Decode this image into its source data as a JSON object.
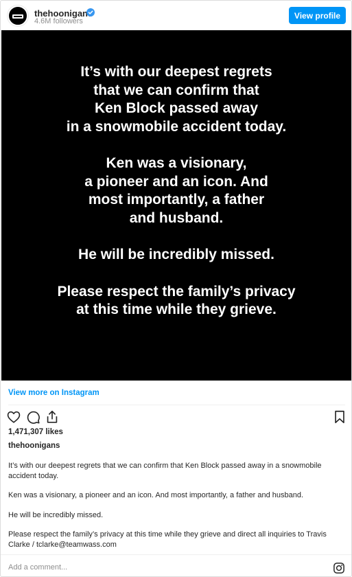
{
  "header": {
    "username": "thehoonigans",
    "followers": "4.6M followers",
    "view_profile_label": "View profile"
  },
  "post": {
    "text_paragraphs": [
      [
        "It’s with our deepest regrets",
        "that we can confirm that",
        "Ken Block passed away",
        "in a snowmobile accident today."
      ],
      [
        "Ken was a visionary,",
        "a pioneer and an icon. And",
        "most importantly, a father",
        "and husband."
      ],
      [
        "He will be incredibly missed."
      ],
      [
        "Please respect the family’s privacy",
        "at this time while they grieve."
      ]
    ]
  },
  "view_more_label": "View more on Instagram",
  "likes": "1,471,307 likes",
  "caption": {
    "username": "thehoonigans",
    "paragraphs": [
      "It’s with our deepest regrets that we can confirm that Ken Block passed away in a snowmobile accident today.",
      "Ken was a visionary, a pioneer and an icon. And most importantly, a father and husband.",
      "He will be incredibly missed.",
      "Please respect the family’s privacy at this time while they grieve and direct all inquiries to Travis Clarke / tclarke@teamwass.com"
    ]
  },
  "comment_placeholder": "Add a comment...",
  "colors": {
    "accent": "#0095f6",
    "verified": "#3897f0",
    "muted": "#8e8e8e",
    "post_background": "#000000"
  },
  "icons": {
    "like": "heart-icon",
    "comment": "comment-icon",
    "share": "share-icon",
    "save": "bookmark-icon",
    "instagram": "instagram-icon",
    "verified": "verified-badge-icon"
  }
}
